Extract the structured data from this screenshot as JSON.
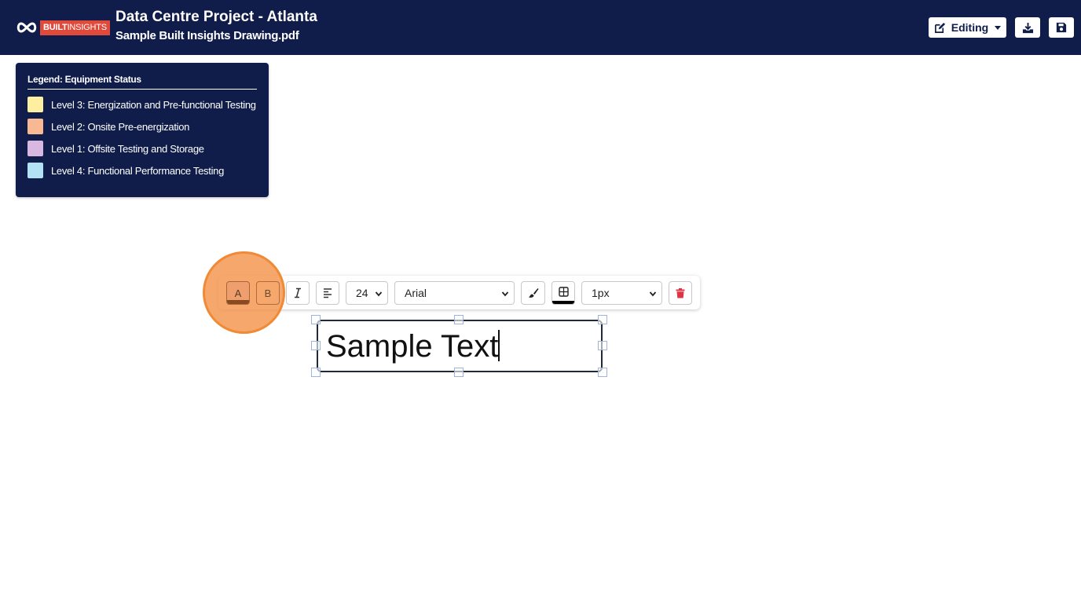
{
  "header": {
    "logo_text_bold": "BUILT",
    "logo_text_regular": "INSIGHTS",
    "project_title": "Data Centre Project - Atlanta",
    "file_name": "Sample Built Insights Drawing.pdf",
    "mode_button_label": "Editing",
    "icons": [
      "infinity-logo-icon",
      "edit-icon",
      "download-icon",
      "save-icon"
    ]
  },
  "legend": {
    "title": "Legend: Equipment Status",
    "items": [
      {
        "label": "Level 3: Energization and Pre-functional Testing",
        "color": "#fdeea0"
      },
      {
        "label": "Level 2: Onsite Pre-energization",
        "color": "#f8b894"
      },
      {
        "label": "Level 1: Offsite Testing and Storage",
        "color": "#d8b8e0"
      },
      {
        "label": "Level 4: Functional Performance Testing",
        "color": "#b2e2f4"
      }
    ]
  },
  "toolbar": {
    "text_color_label": "A",
    "background_color_label": "B",
    "font_size": "24",
    "font_family": "Arial",
    "border_width": "1px",
    "icons": [
      "italic-icon",
      "align-left-icon",
      "brush-icon",
      "border-icon",
      "trash-icon"
    ],
    "text_color_swatch": "#8a4a20",
    "border_color_swatch": "#000000"
  },
  "textbox": {
    "text": "Sample Text"
  },
  "colors": {
    "header_bg": "#101d4a",
    "highlight": "#f4944c",
    "delete_icon": "#dc3545"
  }
}
